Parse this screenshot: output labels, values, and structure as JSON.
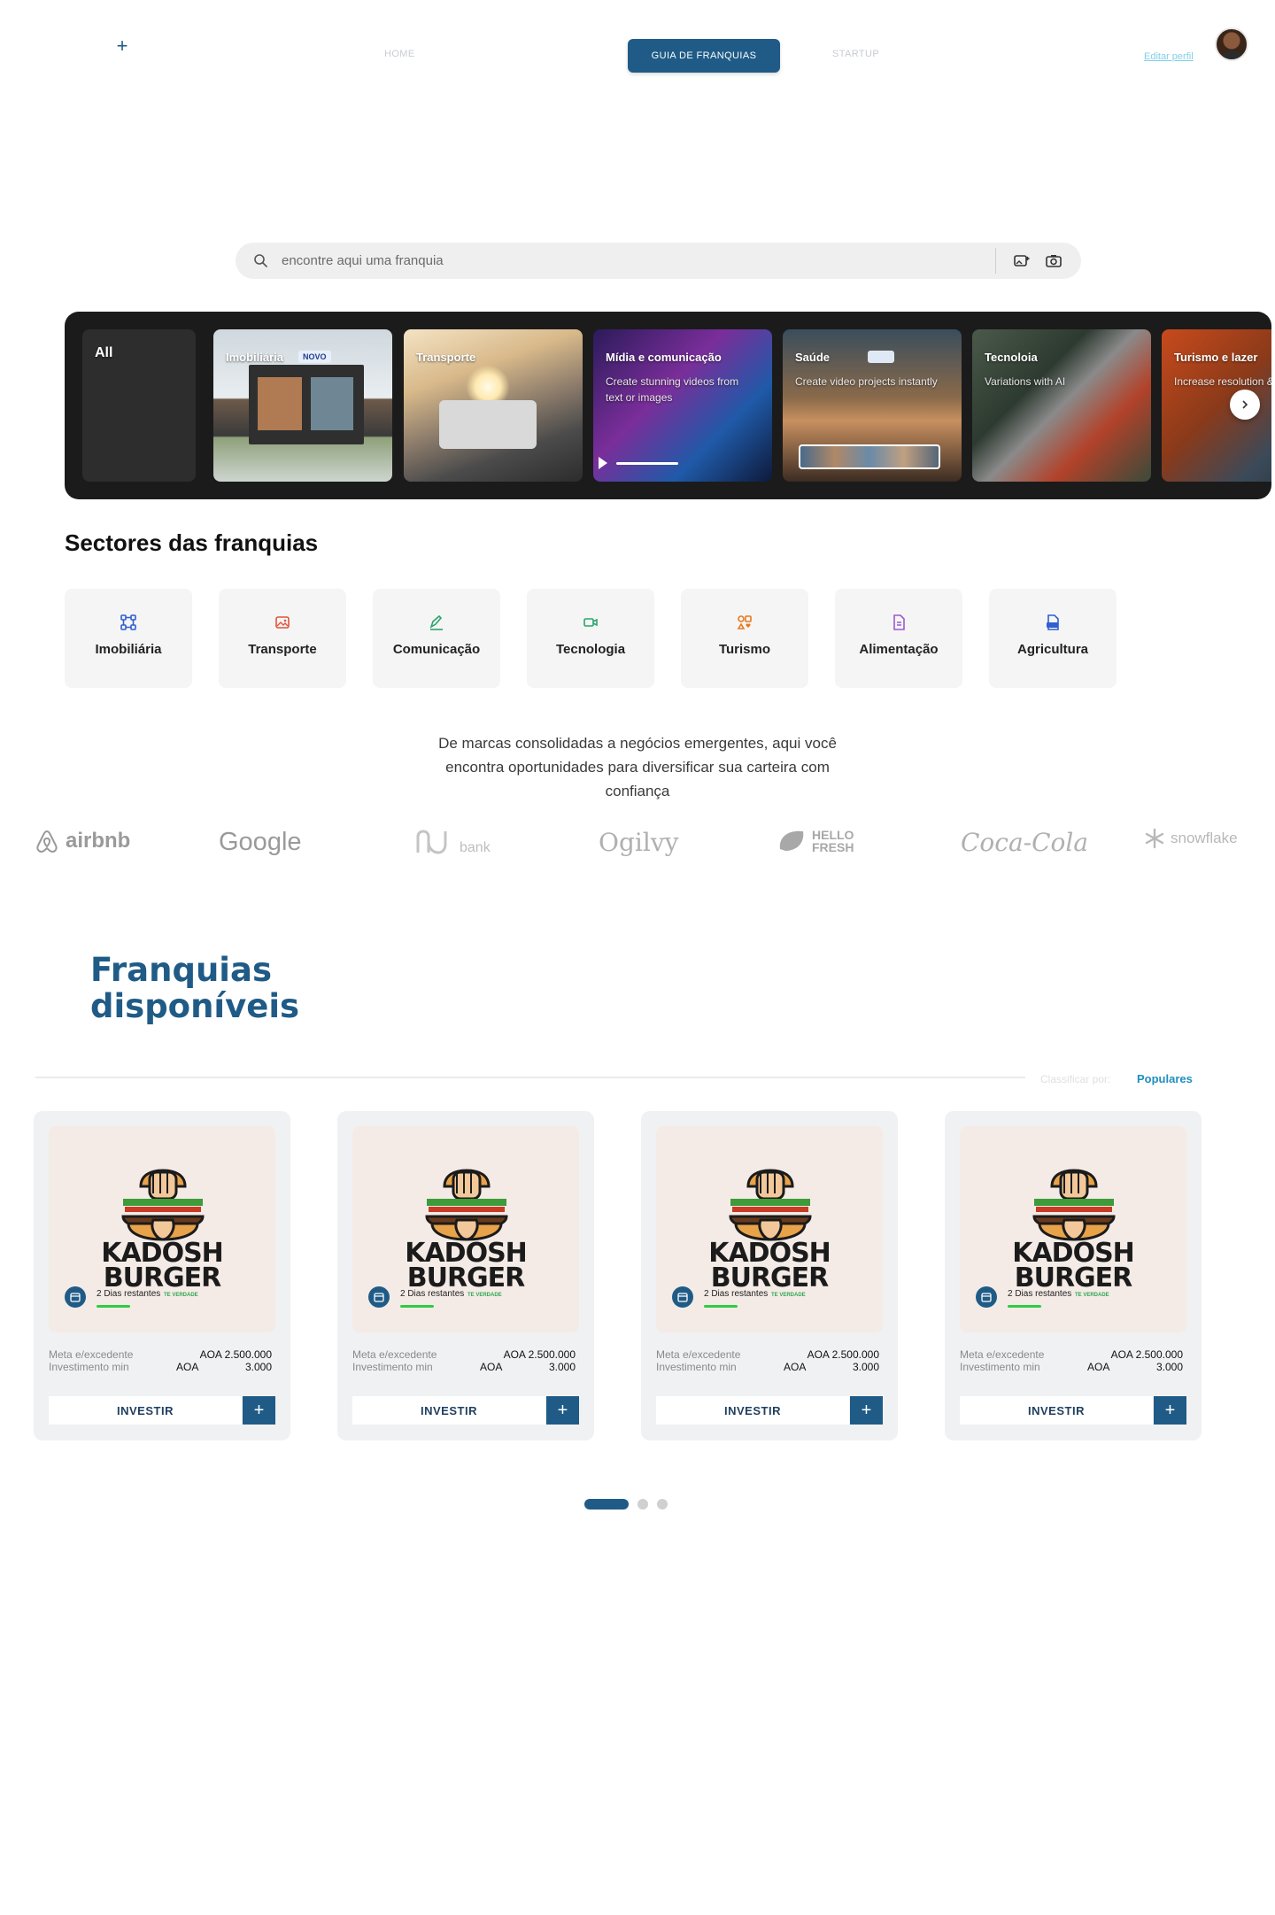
{
  "header": {
    "nav": {
      "home": "HOME",
      "guide": "GUIA DE FRANQUIAS",
      "startup": "STARTUP"
    },
    "edit_profile": "Editar perfil"
  },
  "search": {
    "placeholder": "encontre aqui uma franquia"
  },
  "carousel": {
    "items": [
      {
        "title": "All"
      },
      {
        "title": "Imobiliária",
        "badge": "NOVO"
      },
      {
        "title": "Transporte"
      },
      {
        "title": "Mídia e comunicação",
        "subtitle": "Create stunning videos from text or images"
      },
      {
        "title": "Saúde",
        "subtitle": "Create video projects instantly"
      },
      {
        "title": "Tecnoloia",
        "subtitle": "Variations with AI"
      },
      {
        "title": "Turismo e lazer",
        "subtitle": "Increase resolution & details"
      }
    ]
  },
  "sectors": {
    "title": "Sectores das franquias",
    "items": [
      {
        "label": "Imobiliária",
        "icon": "network-icon",
        "color": "#2f5fd0"
      },
      {
        "label": "Transporte",
        "icon": "image-icon",
        "color": "#e2533b"
      },
      {
        "label": "Comunicação",
        "icon": "pen-icon",
        "color": "#2aa56b"
      },
      {
        "label": "Tecnologia",
        "icon": "video-icon",
        "color": "#2aa56b"
      },
      {
        "label": "Turismo",
        "icon": "shapes-icon",
        "color": "#e87a1c"
      },
      {
        "label": "Alimentação",
        "icon": "document-icon",
        "color": "#9b59d0"
      },
      {
        "label": "Agricultura",
        "icon": "psd-icon",
        "color": "#2f5fd0"
      }
    ]
  },
  "intro": "De marcas consolidadas a negócios emergentes, aqui você encontra oportunidades para diversificar sua carteira com confiança",
  "logos": [
    "airbnb",
    "Google",
    "bank",
    "Ogilvy",
    "HELLO FRESH",
    "Coca-Cola",
    "snowflake"
  ],
  "franchises": {
    "title": "Franquias disponíveis",
    "sort_label": "Classificar por:",
    "sort_value": "Populares",
    "cards": [
      {
        "brand_line1": "KADOSH",
        "brand_line2": "BURGER",
        "tagline": "TE VERDADE",
        "days": "2 Dias restantes",
        "meta_label": "Meta e/excedente",
        "meta_value": "AOA 2.500.000",
        "min_label": "Investimento min",
        "min_currency": "AOA",
        "min_value": "3.000",
        "invest": "INVESTIR",
        "progress": 0.15
      },
      {
        "brand_line1": "KADOSH",
        "brand_line2": "BURGER",
        "tagline": "TE VERDADE",
        "days": "2 Dias restantes",
        "meta_label": "Meta e/excedente",
        "meta_value": "AOA 2.500.000",
        "min_label": "Investimento min",
        "min_currency": "AOA",
        "min_value": "3.000",
        "invest": "INVESTIR",
        "progress": 0.15
      },
      {
        "brand_line1": "KADOSH",
        "brand_line2": "BURGER",
        "tagline": "TE VERDADE",
        "days": "2 Dias restantes",
        "meta_label": "Meta e/excedente",
        "meta_value": "AOA 2.500.000",
        "min_label": "Investimento min",
        "min_currency": "AOA",
        "min_value": "3.000",
        "invest": "INVESTIR",
        "progress": 0.15
      },
      {
        "brand_line1": "KADOSH",
        "brand_line2": "BURGER",
        "tagline": "TE VERDADE",
        "days": "2 Dias restantes",
        "meta_label": "Meta e/excedente",
        "meta_value": "AOA 2.500.000",
        "min_label": "Investimento min",
        "min_currency": "AOA",
        "min_value": "3.000",
        "invest": "INVESTIR",
        "progress": 0.15
      }
    ]
  },
  "pagination": {
    "pages": 3,
    "active": 0
  },
  "colors": {
    "primary": "#1f5b86",
    "accent": "#1f8fbf",
    "progress": "#2ecc40"
  }
}
